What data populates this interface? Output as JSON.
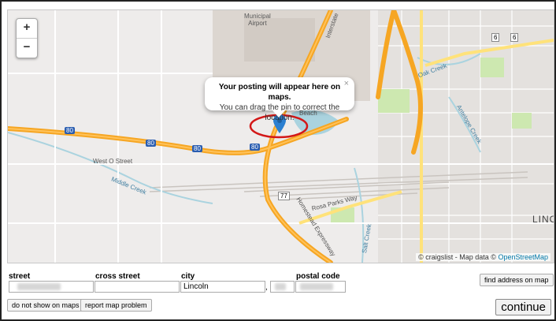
{
  "map": {
    "zoom_in": "+",
    "zoom_out": "−",
    "popup_title": "Your posting will appear here on maps.",
    "popup_text": "You can drag the pin to correct the location.",
    "popup_close": "×",
    "attribution_prefix": "© craigslist - Map data ©",
    "attribution_link": "OpenStreetMap",
    "labels": {
      "airport": "Municipal\nAirport",
      "west_o_street": "West O Street",
      "middle_creek": "Middle Creek",
      "rosa_parks_way": "Rosa Parks Way",
      "homestead_expressway": "Homestead Expressway",
      "oak_creek": "Oak Creek",
      "antelope_creek": "Antelope Creek",
      "salt_creek": "Salt Creek",
      "lincoln_partial": "LINC",
      "beach": "Beach",
      "interstate": "Interstate"
    },
    "shields": [
      "80",
      "80",
      "80",
      "80",
      "77",
      "6",
      "6"
    ],
    "colors": {
      "highway": "#f6a623",
      "highway_edge": "#e08b10",
      "major_road": "#ffe27a",
      "water": "#aad3df",
      "park": "#cde8b0",
      "pin": "#2b7fd0",
      "circle": "#d31818"
    }
  },
  "form": {
    "street_label": "street",
    "cross_street_label": "cross street",
    "city_label": "city",
    "city_value": "Lincoln",
    "comma": ",",
    "postal_code_label": "postal code",
    "find_address_button": "find address on map",
    "do_not_show_button": "do not show on maps",
    "report_problem_button": "report map problem",
    "continue_button": "continue"
  }
}
